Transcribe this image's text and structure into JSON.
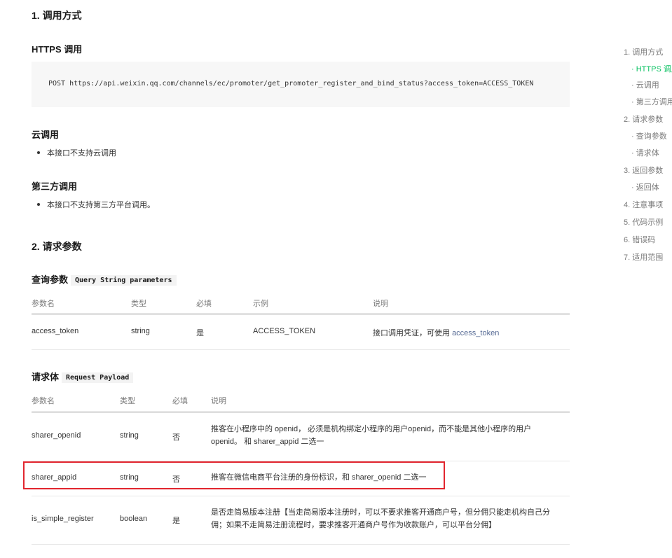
{
  "section1": {
    "title": "1. 调用方式",
    "https_heading": "HTTPS 调用",
    "code": "POST https://api.weixin.qq.com/channels/ec/promoter/get_promoter_register_and_bind_status?access_token=ACCESS_TOKEN",
    "cloud_heading": "云调用",
    "cloud_bullet": "本接口不支持云调用",
    "third_heading": "第三方调用",
    "third_bullet": "本接口不支持第三方平台调用。"
  },
  "section2": {
    "title": "2. 请求参数",
    "query": {
      "heading": "查询参数",
      "tag": "Query String parameters",
      "headers": [
        "参数名",
        "类型",
        "必填",
        "示例",
        "说明"
      ],
      "row": {
        "name": "access_token",
        "type": "string",
        "required": "是",
        "example": "ACCESS_TOKEN",
        "desc_prefix": "接口调用凭证，可使用 ",
        "desc_link": "access_token"
      }
    },
    "payload": {
      "heading": "请求体",
      "tag": "Request Payload",
      "headers": [
        "参数名",
        "类型",
        "必填",
        "说明"
      ],
      "rows": [
        {
          "name": "sharer_openid",
          "type": "string",
          "required": "否",
          "desc_line1": "推客在小程序中的 openid， 必须是机构绑定小程序的用户openid，而不能是其他小程序的用户",
          "desc_line2": "openid。 和 sharer_appid 二选一"
        },
        {
          "name": "sharer_appid",
          "type": "string",
          "required": "否",
          "desc_line1": "推客在微信电商平台注册的身份标识，和 sharer_openid 二选一",
          "desc_line2": ""
        },
        {
          "name": "is_simple_register",
          "type": "boolean",
          "required": "是",
          "desc_line1": "是否走简易版本注册【当走简易版本注册时，可以不要求推客开通商户号，但分佣只能走机构自己分",
          "desc_line2": "佣；如果不走简易注册流程时，要求推客开通商户号作为收款账户，可以平台分佣】"
        }
      ]
    }
  },
  "toc": {
    "items": [
      {
        "label": "1. 调用方式",
        "sub": false,
        "active": false
      },
      {
        "label": "· HTTPS 调用",
        "sub": true,
        "active": true
      },
      {
        "label": "· 云调用",
        "sub": true,
        "active": false
      },
      {
        "label": "· 第三方调用",
        "sub": true,
        "active": false
      },
      {
        "label": "2. 请求参数",
        "sub": false,
        "active": false
      },
      {
        "label": "· 查询参数",
        "sub": true,
        "active": false
      },
      {
        "label": "· 请求体",
        "sub": true,
        "active": false
      },
      {
        "label": "3. 返回参数",
        "sub": false,
        "active": false
      },
      {
        "label": "· 返回体",
        "sub": true,
        "active": false
      },
      {
        "label": "4. 注意事项",
        "sub": false,
        "active": false
      },
      {
        "label": "5. 代码示例",
        "sub": false,
        "active": false
      },
      {
        "label": "6. 错误码",
        "sub": false,
        "active": false
      },
      {
        "label": "7. 适用范围",
        "sub": false,
        "active": false
      }
    ]
  },
  "colors": {
    "accent": "#07c160",
    "link": "#576b95",
    "highlight_border": "#e2262f"
  }
}
